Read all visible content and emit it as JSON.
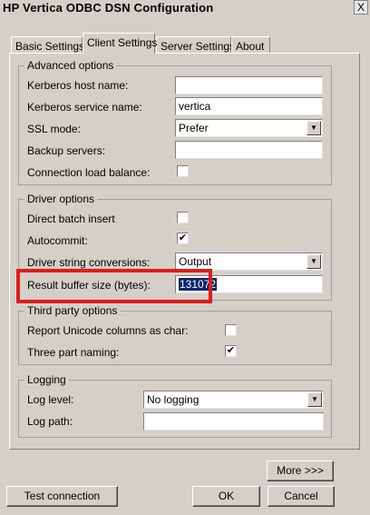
{
  "window": {
    "title": "HP Vertica ODBC DSN Configuration",
    "close": "X"
  },
  "tabs": [
    {
      "label": "Basic Settings"
    },
    {
      "label": "Client Settings"
    },
    {
      "label": "Server Settings"
    },
    {
      "label": "About"
    }
  ],
  "advanced": {
    "title": "Advanced options",
    "kerberos_host_label": "Kerberos host name:",
    "kerberos_host_value": "",
    "kerberos_service_label": "Kerberos service name:",
    "kerberos_service_value": "vertica",
    "ssl_label": "SSL mode:",
    "ssl_value": "Prefer",
    "backup_label": "Backup servers:",
    "backup_value": "",
    "lb_label": "Connection load balance:",
    "lb_checked": false
  },
  "driver": {
    "title": "Driver options",
    "batch_label": "Direct batch insert",
    "batch_checked": false,
    "autocommit_label": "Autocommit:",
    "autocommit_checked": true,
    "conv_label": "Driver string conversions:",
    "conv_value": "Output",
    "buffer_label": "Result buffer size (bytes):",
    "buffer_value": "131072"
  },
  "thirdparty": {
    "title": "Third party options",
    "unicode_label": "Report Unicode columns as char:",
    "unicode_checked": false,
    "threepart_label": "Three part naming:",
    "threepart_checked": true
  },
  "logging": {
    "title": "Logging",
    "level_label": "Log level:",
    "level_value": "No logging",
    "path_label": "Log path:",
    "path_value": ""
  },
  "buttons": {
    "more": "More >>>",
    "test": "Test connection",
    "ok": "OK",
    "cancel": "Cancel"
  },
  "glyphs": {
    "check": "✔",
    "arrow": "▼"
  }
}
